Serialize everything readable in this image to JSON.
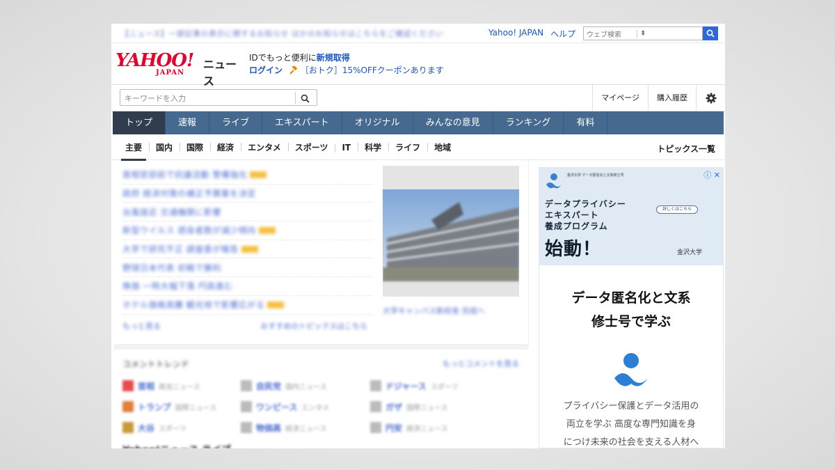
{
  "topbar": {
    "notice": "【ニュース】一部記事の表示に関するお知らせ ほかのお知らせはこちらをご確認ください",
    "links": [
      "Yahoo! JAPAN",
      "ヘルプ"
    ],
    "web_search_placeholder": "ウェブ検索"
  },
  "logo": {
    "yahoo": "YAHOO!",
    "japan": "JAPAN",
    "service": "ニュース"
  },
  "account": {
    "line1_prefix": "IDでもっと便利に",
    "signup": "新規取得",
    "login": "ログイン",
    "coupon": "［おトク］15%OFFクーポンあります"
  },
  "search": {
    "placeholder": "キーワードを入力"
  },
  "user_links": [
    "マイページ",
    "購入履歴"
  ],
  "main_nav": [
    "トップ",
    "速報",
    "ライブ",
    "エキスパート",
    "オリジナル",
    "みんなの意見",
    "ランキング",
    "有料"
  ],
  "sub_nav": [
    "主要",
    "国内",
    "国際",
    "経済",
    "エンタメ",
    "スポーツ",
    "IT",
    "科学",
    "ライフ",
    "地域"
  ],
  "topics_all": "トピックス一覧",
  "headlines": [
    "首相官邸前で抗議活動 警備強化",
    "政府 経済対策の補正予算案を決定",
    "台風接近 交通機関に影響",
    "新型ウイルス 感染者数が減少傾向",
    "大学で研究不正 調査委が報告",
    "野球日本代表 初戦で勝利",
    "株価 一時大幅下落 円高進む",
    "ホテル価格高騰 観光地で影響広がる"
  ],
  "headlines_more_left": "もっと見る",
  "headlines_more_right": "おすすめのトピックスはこちら",
  "pickup_caption": "大学キャンパス新校舎 完成へ",
  "comments": {
    "title": "コメントトレンド",
    "more": "もっとコメントを見る",
    "items": [
      {
        "word": "首相",
        "sub": "政治ニュース"
      },
      {
        "word": "自民党",
        "sub": "国内ニュース"
      },
      {
        "word": "ドジャース",
        "sub": "スポーツ"
      },
      {
        "word": "トランプ",
        "sub": "国際ニュース"
      },
      {
        "word": "ワンピース",
        "sub": "エンタメ"
      },
      {
        "word": "ガザ",
        "sub": "国際ニュース"
      },
      {
        "word": "大谷",
        "sub": "スポーツ"
      },
      {
        "word": "物価高",
        "sub": "経済ニュース"
      },
      {
        "word": "円安",
        "sub": "経済ニュース"
      }
    ]
  },
  "live_title": "Yahoo!ニュース ライブ",
  "ad": {
    "banner_title_lines": [
      "データプライバシー",
      "エキスパート",
      "養成プログラム"
    ],
    "banner_big": "始動！",
    "banner_button": "詳しくはこちら",
    "banner_univ": "金沢大学",
    "banner_head": "金沢大学 データ匿名化と文系修士号",
    "heading_lines": [
      "データ匿名化と文系",
      "修士号で学ぶ"
    ],
    "body_lines": [
      "プライバシー保護とデータ活用の",
      "両立を学ぶ 高度な専門知識を身",
      "につけ未来の社会を支える人材へ"
    ]
  },
  "colors": {
    "nav": "#46698f",
    "nav_active": "#2f3d4d",
    "link": "#1a55c3",
    "brand": "#e6002d"
  }
}
